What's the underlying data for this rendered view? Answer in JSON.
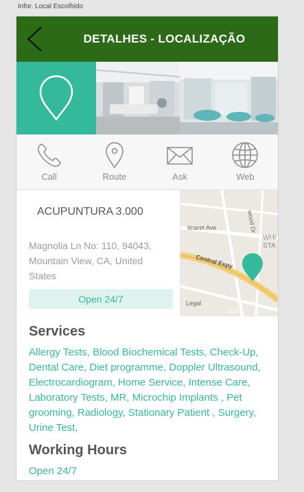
{
  "caption": "Infor. Local Escolhido",
  "header": {
    "title": "DETALHES - LOCALIZAÇÃO",
    "back_icon": "chevron-left-icon"
  },
  "colors": {
    "header_bg": "#2d6a18",
    "accent": "#34b99a",
    "badge_bg": "#dff3ee"
  },
  "actions": [
    {
      "label": "Call",
      "icon": "phone-icon"
    },
    {
      "label": "Route",
      "icon": "map-pin-icon"
    },
    {
      "label": "Ask",
      "icon": "envelope-icon"
    },
    {
      "label": "Web",
      "icon": "globe-icon"
    }
  ],
  "place": {
    "name": "ACUPUNTURA 3.000",
    "address_lines": [
      "Magnolia Ln No: 110, 94043,",
      "Mountain View, CA, United",
      "States"
    ],
    "hours_badge": "Open 24/7"
  },
  "map": {
    "labels": [
      "tinaret Ave",
      "Central Expy",
      "wood Dr",
      "WHI",
      "STA",
      "Legal",
      "237"
    ]
  },
  "services": {
    "title": "Services",
    "lines": [
      "Allergy Tests, Blood Biochemical Tests, Check-Up,",
      "Dental Care, Diet programme, Doppler Ultrasound,",
      "Electrocardiogram, Home Service, Intense Care,",
      "Laboratory Tests, MR, Microchip Implants , Pet",
      "grooming, Radiology, Stationary Patient , Surgery,",
      "Urine Test,"
    ]
  },
  "working_hours": {
    "title": "Working Hours",
    "value": "Open 24/7"
  }
}
